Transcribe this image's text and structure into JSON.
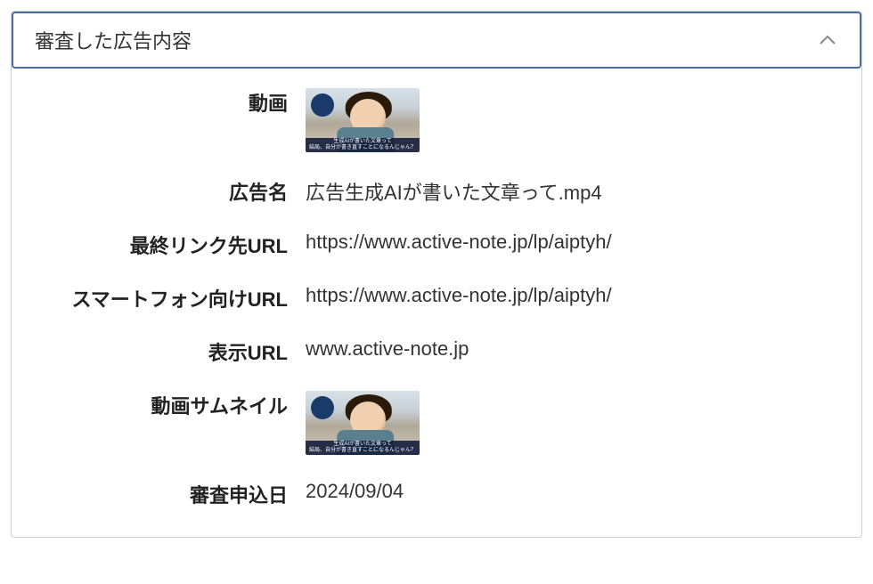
{
  "panel": {
    "title": "審査した広告内容"
  },
  "fields": {
    "video_label": "動画",
    "ad_name_label": "広告名",
    "ad_name_value": "広告生成AIが書いた文章って.mp4",
    "final_url_label": "最終リンク先URL",
    "final_url_value": "https://www.active-note.jp/lp/aiptyh/",
    "mobile_url_label": "スマートフォン向けURL",
    "mobile_url_value": "https://www.active-note.jp/lp/aiptyh/",
    "display_url_label": "表示URL",
    "display_url_value": "www.active-note.jp",
    "thumbnail_label": "動画サムネイル",
    "review_date_label": "審査申込日",
    "review_date_value": "2024/09/04"
  },
  "thumbnail": {
    "caption_line1": "生成AIが書いた文章って",
    "caption_line2": "結局、自分が書き直すことになるんじゃん？"
  }
}
